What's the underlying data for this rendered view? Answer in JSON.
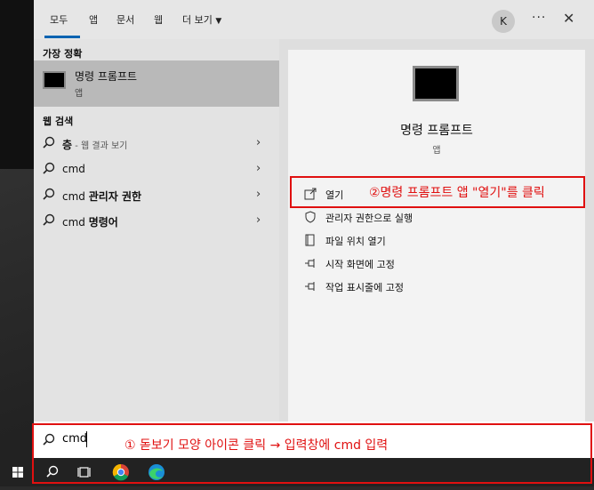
{
  "tabs": [
    "모두",
    "앱",
    "문서",
    "웹",
    "더 보기"
  ],
  "avatar_letter": "K",
  "left": {
    "best_match_title": "가장 정확",
    "best_match": {
      "name": "명령 프롬프트",
      "type": "앱"
    },
    "web_title": "웹 검색",
    "web_results": [
      {
        "main": "층",
        "hint": " - 웹 결과 보기"
      },
      {
        "plain": "cmd",
        "bold": ""
      },
      {
        "plain": "cmd ",
        "bold": "관리자 권한"
      },
      {
        "plain": "cmd ",
        "bold": "명령어"
      }
    ]
  },
  "right": {
    "title": "명령 프롬프트",
    "type": "앱",
    "actions": [
      {
        "label": "열기",
        "icon": "open-icon"
      },
      {
        "label": "관리자 권한으로 실행",
        "icon": "admin-shield-icon"
      },
      {
        "label": "파일 위치 열기",
        "icon": "file-location-icon"
      },
      {
        "label": "시작 화면에 고정",
        "icon": "pin-icon"
      },
      {
        "label": "작업 표시줄에 고정",
        "icon": "pin-icon"
      }
    ]
  },
  "search": {
    "value": "cmd"
  },
  "annotations": {
    "step2": "②명령 프롬프트 앱 \"열기\"를 클릭",
    "step1": "① 돋보기 모양 아이콘 클릭 → 입력창에 cmd 입력"
  },
  "colors": {
    "annotation": "#e01010",
    "accent": "#0063b1"
  }
}
